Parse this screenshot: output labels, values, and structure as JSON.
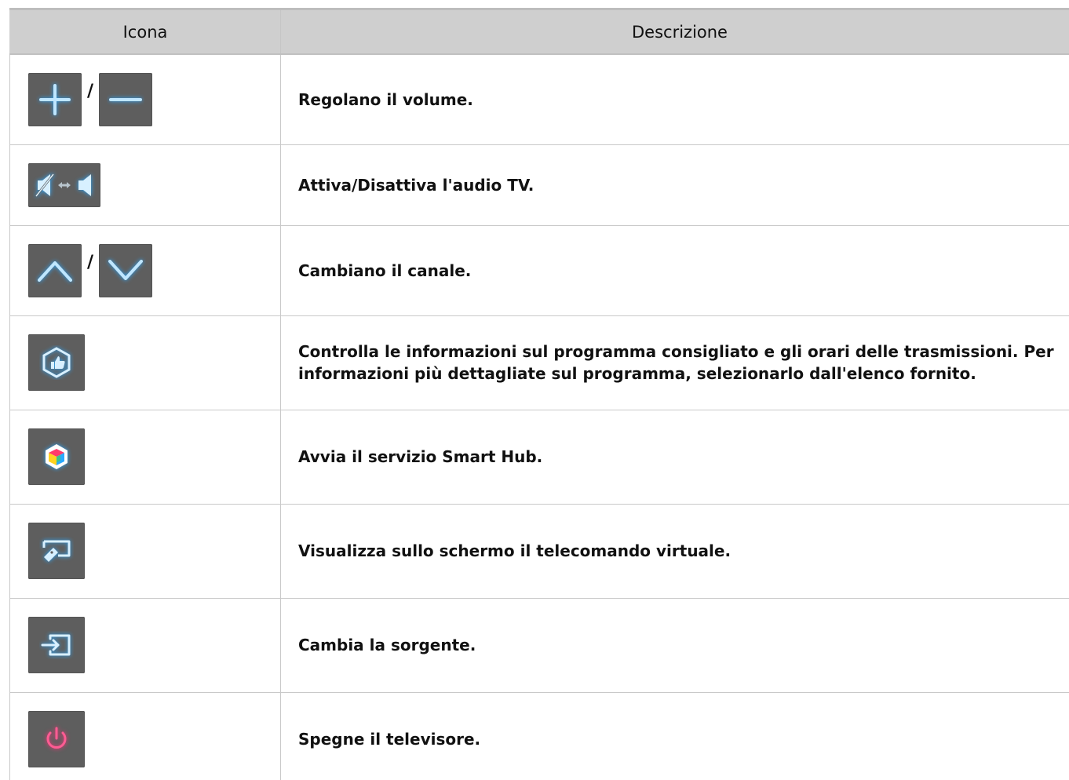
{
  "table": {
    "headers": {
      "icon": "Icona",
      "description": "Descrizione"
    },
    "separator": "/",
    "rows": [
      {
        "icons": [
          "plus-icon",
          "minus-icon"
        ],
        "description": "Regolano il volume."
      },
      {
        "icons": [
          "mute-toggle-icon"
        ],
        "description": "Attiva/Disattiva l'audio TV."
      },
      {
        "icons": [
          "chevron-up-icon",
          "chevron-down-icon"
        ],
        "description": "Cambiano il canale."
      },
      {
        "icons": [
          "recommended-icon"
        ],
        "description": "Controlla le informazioni sul programma consigliato e gli orari delle trasmissioni. Per informazioni più dettagliate sul programma, selezionarlo dall'elenco fornito."
      },
      {
        "icons": [
          "smart-hub-icon"
        ],
        "description": "Avvia il servizio Smart Hub."
      },
      {
        "icons": [
          "virtual-remote-icon"
        ],
        "description": "Visualizza sullo schermo il telecomando virtuale."
      },
      {
        "icons": [
          "source-icon"
        ],
        "description": "Cambia la sorgente."
      },
      {
        "icons": [
          "power-icon"
        ],
        "description": "Spegne il televisore."
      }
    ]
  },
  "colors": {
    "button_bg": "#5e5e5e",
    "icon_glow_blue": "#2aa9ff",
    "icon_power_pink": "#ff2f7a",
    "header_bg": "#cfcfcf"
  }
}
